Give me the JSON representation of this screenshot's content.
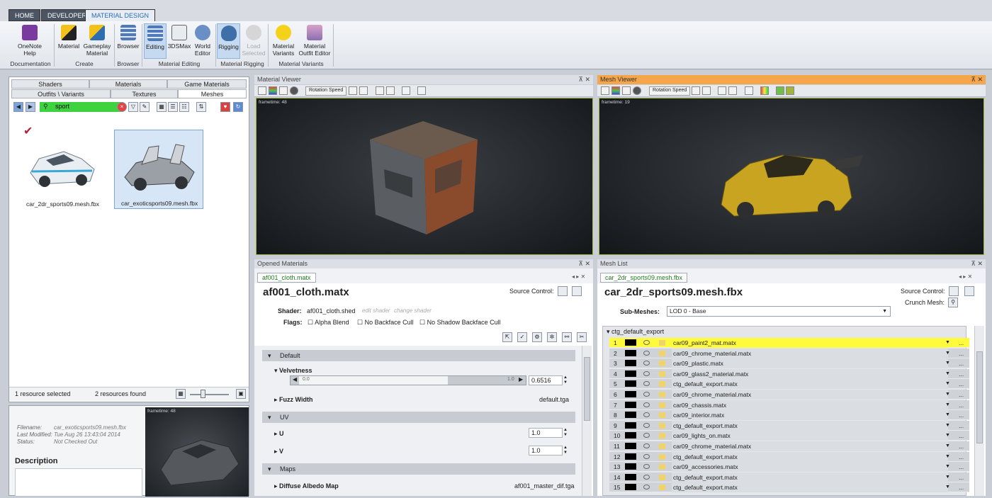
{
  "ribbon": {
    "tabs": [
      "HOME",
      "DEVELOPER",
      "MATERIAL DESIGN"
    ],
    "buttons": {
      "onenote": "OneNote Help",
      "material": "Material",
      "gameplay_material": "Gameplay Material",
      "browser": "Browser",
      "editing": "Editing",
      "threeds": "3DSMax",
      "world_editor": "World Editor",
      "rigging": "Rigging",
      "load_selected": "Load Selected",
      "material_variants": "Material Variants",
      "outfit_editor": "Material Outfit Editor"
    },
    "groups": {
      "documentation": "Documentation",
      "create": "Create",
      "browser": "Browser",
      "material_editing": "Material Editing",
      "material_rigging": "Material Rigging",
      "material_variants": "Material Variants"
    }
  },
  "left": {
    "tabs": {
      "shaders": "Shaders",
      "materials": "Materials",
      "game_materials": "Game Materials",
      "outfits": "Outfits \\ Variants",
      "textures": "Textures",
      "meshes": "Meshes"
    },
    "search_value": "sport",
    "items": [
      "car_2dr_sports09.mesh.fbx",
      "car_exoticsports09.mesh.fbx"
    ],
    "status_selected": "1 resource selected",
    "status_found": "2 resources found",
    "details": {
      "filename_key": "Filename:",
      "filename_val": "car_exoticsports09.mesh.fbx",
      "modified_key": "Last Modified:",
      "modified_val": "Tue Aug 26 13:43:04 2014",
      "status_key": "Status:",
      "status_val": "Not Checked Out",
      "description_label": "Description",
      "frametime": "frametime: 48"
    }
  },
  "material_viewer": {
    "title": "Material Viewer",
    "rotation_label": "Rotation Speed",
    "frametime": "frametime: 48"
  },
  "mesh_viewer": {
    "title": "Mesh Viewer",
    "rotation_label": "Rotation Speed",
    "frametime": "frametime: 19"
  },
  "opened_materials": {
    "title": "Opened Materials",
    "tab": "af001_cloth.matx",
    "heading": "af001_cloth.matx",
    "source_control": "Source Control:",
    "shader_label": "Shader:",
    "shader_value": "af001_cloth.shed",
    "edit_shader": "edit shader",
    "change_shader": "change shader",
    "flags_label": "Flags:",
    "flags": [
      "Alpha Blend",
      "No Backface Cull",
      "No Shadow Backface Cull"
    ],
    "sections": {
      "default": "Default",
      "uv": "UV",
      "maps": "Maps"
    },
    "velvetness_label": "Velvetness",
    "slider_min": "0.0",
    "slider_max": "1.0",
    "velvetness_value": "0.6516",
    "fuzz_label": "Fuzz Width",
    "fuzz_value": "default.tga",
    "u_label": "U",
    "u_value": "1.0",
    "v_label": "V",
    "v_value": "1.0",
    "albedo_label": "Diffuse Albedo Map",
    "albedo_value": "af001_master_dif.tga"
  },
  "mesh_list": {
    "title": "Mesh List",
    "tab": "car_2dr_sports09.mesh.fbx",
    "heading": "car_2dr_sports09.mesh.fbx",
    "source_control": "Source Control:",
    "crunch_mesh": "Crunch Mesh:",
    "submeshes_label": "Sub-Meshes:",
    "submeshes_value": "LOD 0 - Base",
    "group": "ctg_default_export",
    "rows": [
      {
        "num": "1",
        "name": "car09_paint2_mat.matx"
      },
      {
        "num": "2",
        "name": "car09_chrome_material.matx"
      },
      {
        "num": "3",
        "name": "car09_plastic.matx"
      },
      {
        "num": "4",
        "name": "car09_glass2_material.matx"
      },
      {
        "num": "5",
        "name": "ctg_default_export.matx"
      },
      {
        "num": "6",
        "name": "car09_chrome_material.matx"
      },
      {
        "num": "7",
        "name": "car09_chassis.matx"
      },
      {
        "num": "8",
        "name": "car09_interior.matx"
      },
      {
        "num": "9",
        "name": "ctg_default_export.matx"
      },
      {
        "num": "10",
        "name": "car09_lights_on.matx"
      },
      {
        "num": "11",
        "name": "car09_chrome_material.matx"
      },
      {
        "num": "12",
        "name": "ctg_default_export.matx"
      },
      {
        "num": "13",
        "name": "car09_accessories.matx"
      },
      {
        "num": "14",
        "name": "ctg_default_export.matx"
      },
      {
        "num": "15",
        "name": "ctg_default_export.matx"
      }
    ],
    "dots": "..."
  }
}
